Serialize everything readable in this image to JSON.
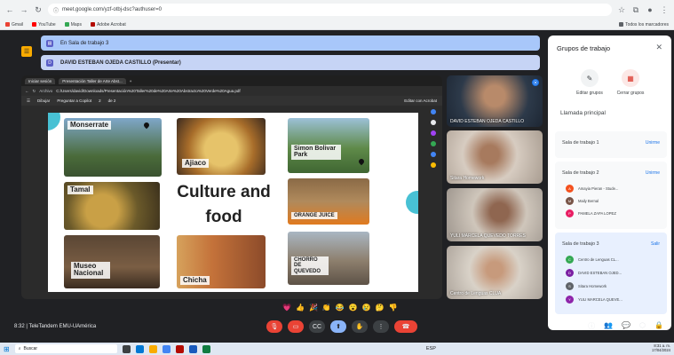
{
  "browser": {
    "url": "meet.google.com/yzf-otbj-dsc?authuser=0",
    "bookmarks": [
      "Gmail",
      "YouTube",
      "Maps",
      "Adobe Acrobat"
    ],
    "all_bookmarks": "Todos los marcadores"
  },
  "meet": {
    "breakout_banner": "En Sala de trabajo 3",
    "presenter_banner": "DAVID ESTEBAN OJEDA CASTILLO (Presentar)",
    "meeting_time": "8:32",
    "meeting_title": "TeleTandem EMU-UAmérica"
  },
  "shared_screen": {
    "tab_session": "Iniciar sesión",
    "tab_pdf": "Presentación Taller de Arte Abst...",
    "file_label": "Archivo",
    "file_path": "C:/Users/david/Downloads/Presentación%20Taller%20de%20Arte%20Abstracto%20Verde%20Agua.pdf",
    "toolbar": {
      "draw": "Dibujar",
      "ask_copilot": "Preguntar a Copilot",
      "page_current": "2",
      "page_total": "de 2",
      "edit_acrobat": "Editar con Acrobat"
    },
    "slide": {
      "title_line1": "Culture and",
      "title_line2": "food",
      "labels": {
        "monserrate": "Monserrate",
        "ajiaco": "Ajiaco",
        "simon": "Simon Bolivar Park",
        "tamal": "Tamal",
        "orange": "ORANGE JUICE",
        "museo": "Museo Nacional",
        "chicha": "Chicha",
        "chorro": "CHORRO DE QUEVEDO"
      }
    }
  },
  "participants": [
    "DAVID ESTEBAN OJEDA CASTILLO",
    "Sitara Homework",
    "YULI MARCELA QUEVEDO TORRES",
    "Centro de Lenguas CLUA"
  ],
  "panel": {
    "title": "Grupos de trabajo",
    "edit_groups": "Editar grupos",
    "close_rooms": "Cerrar grupos",
    "main_call": "Llamada principal",
    "rooms": [
      {
        "name": "Sala de trabajo 1",
        "action": "Unirme",
        "members": []
      },
      {
        "name": "Sala de trabajo 2",
        "action": "Unirme",
        "members": [
          "Amayia Pieran - Stude...",
          "Maily Bernal",
          "PAMELA ZAPA LOPEZ"
        ]
      },
      {
        "name": "Sala de trabajo 3",
        "action": "Salir",
        "members": [
          "Centro de Lenguas CL...",
          "DAVID ESTEBAN OJED...",
          "Sitara Homework",
          "YULI MARCELA QUEVE..."
        ]
      }
    ]
  },
  "taskbar": {
    "search_placeholder": "Buscar",
    "time": "8:31 a. m.",
    "date": "17/04/2024",
    "lang": "ESP"
  },
  "colors": {
    "accent_blue": "#1a73e8",
    "banner_blue": "#a8c7fa",
    "end_call_red": "#ea4335",
    "slide_teal": "#48c1d4"
  }
}
